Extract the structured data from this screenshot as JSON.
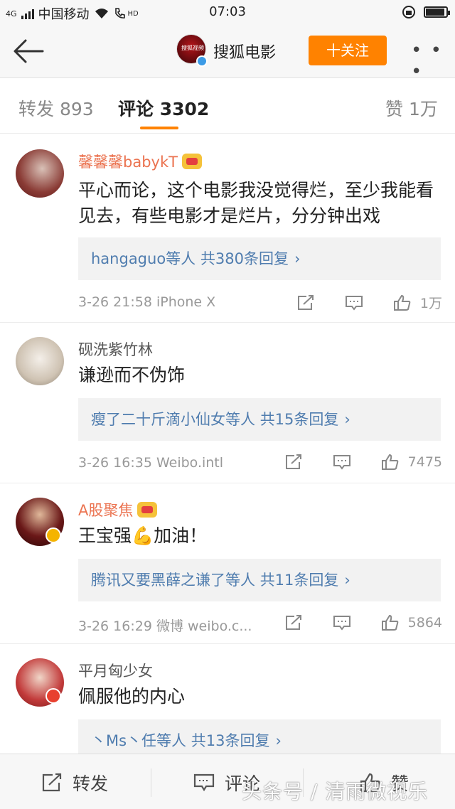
{
  "status_bar": {
    "network": "4G",
    "carrier": "中国移动",
    "hd": "HD",
    "time": "07:03"
  },
  "header": {
    "channel_name": "搜狐电影",
    "avatar_text": "搜狐视频",
    "follow_label": "十关注",
    "more_label": "• • •"
  },
  "tabs": [
    {
      "label": "转发 893"
    },
    {
      "label": "评论 3302"
    },
    {
      "label": "赞 1万"
    }
  ],
  "comments": [
    {
      "user": "馨馨馨babykT",
      "text": "平心而论，这个电影我没觉得烂，至少我能看见去，有些电影才是烂片，分分钟出戏",
      "reply_users": "hangaguo等人",
      "reply_count": "共380条回复",
      "time_source": "3-26 21:58  iPhone X",
      "likes": "1万"
    },
    {
      "user": "砚洗紫竹林",
      "text": "谦逊而不伪饰",
      "reply_users": "瘦了二十斤滴小仙女等人",
      "reply_count": "共15条回复",
      "time_source": "3-26 16:35  Weibo.intl",
      "likes": "7475"
    },
    {
      "user": "A股聚焦",
      "text": "王宝强💪加油！",
      "reply_users": "腾讯又要黑薛之谦了等人",
      "reply_count": "共11条回复",
      "time_source": "3-26 16:29  微博 weibo.c...",
      "likes": "5864"
    },
    {
      "user": "平月匈少女",
      "text": "佩服他的内心",
      "reply_users": "丶Ms丶任等人",
      "reply_count": "共13条回复",
      "time_source": "",
      "likes": ""
    }
  ],
  "bottom_bar": {
    "repost": "转发",
    "comment": "评论",
    "like": "赞"
  },
  "watermark": "头条号 / 清雨微视乐",
  "colors": {
    "accent": "#ff8200",
    "vip_name": "#eb7350",
    "link": "#507daf"
  }
}
